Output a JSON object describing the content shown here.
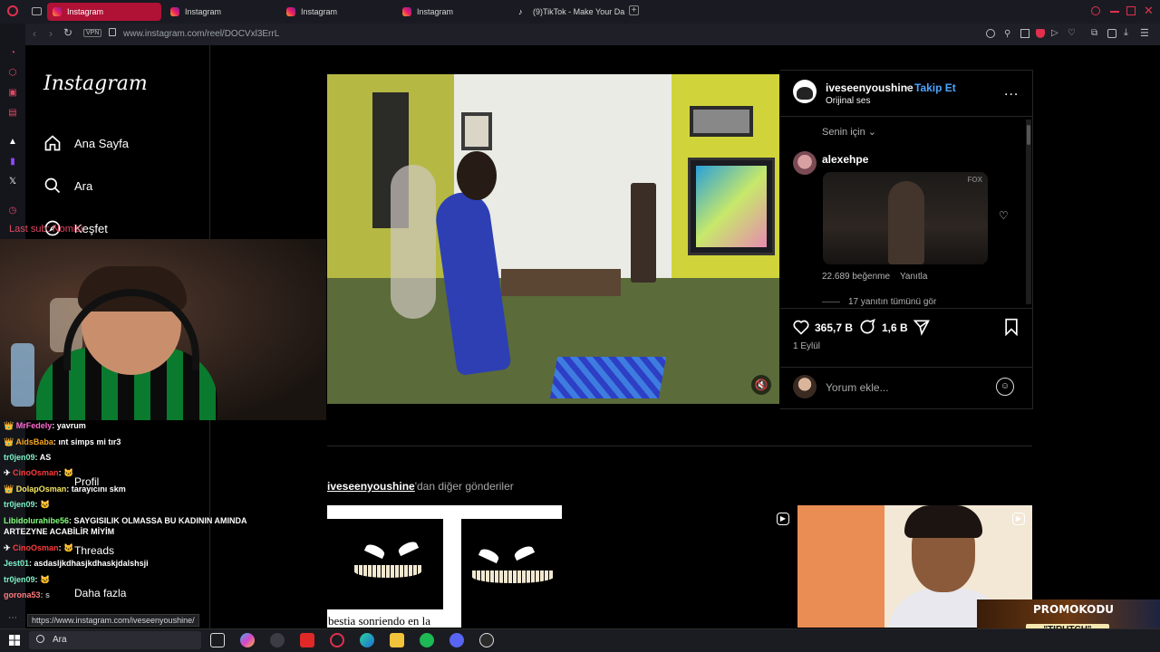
{
  "browser": {
    "tabs": [
      {
        "label": "Instagram",
        "active": true
      },
      {
        "label": "Instagram",
        "active": false
      },
      {
        "label": "Instagram",
        "active": false
      },
      {
        "label": "Instagram",
        "active": false
      },
      {
        "label": "(9)TikTok - Make Your Da",
        "active": false
      }
    ],
    "vpn_label": "VPN",
    "url": "www.instagram.com/reel/DOCVxl3ErrL",
    "status_url": "https://www.instagram.com/iveseenyoushine/"
  },
  "instagram": {
    "logo": "Instagram",
    "nav": [
      {
        "label": "Ana Sayfa",
        "icon": "home-icon"
      },
      {
        "label": "Ara",
        "icon": "search-icon"
      },
      {
        "label": "Keşfet",
        "icon": "compass-icon"
      }
    ],
    "nav_lower": [
      {
        "label": "Profil"
      },
      {
        "label": "Threads"
      },
      {
        "label": "Daha fazla"
      }
    ]
  },
  "overlay": {
    "last_sub": "Last sub: Nomisi"
  },
  "chat": [
    {
      "user": "MrFedely",
      "msg": "yavrum"
    },
    {
      "user": "AidsBaba",
      "msg": "ınt simps mi tır3"
    },
    {
      "user": "tr0jen09",
      "msg": "AS"
    },
    {
      "user": "CinoOsman",
      "msg": "🐱"
    },
    {
      "user": "DolapOsman",
      "msg": "tarayıcını skm"
    },
    {
      "user": "tr0jen09",
      "msg": "🐱"
    },
    {
      "user": "Libidolurahibe56",
      "msg": "SAYGISILIK OLMASSA BU KADININ AMINDA"
    },
    {
      "user": "",
      "msg": "ARTEZYNE ACABİLİR MİYİM"
    },
    {
      "user": "CinoOsman",
      "msg": "🐱"
    },
    {
      "user": "Jest01",
      "msg": "asdasljkdhasjkdhaskjdalshsji"
    },
    {
      "user": "tr0jen09",
      "msg": "🐱"
    },
    {
      "user": "gorona53",
      "msg": "s"
    }
  ],
  "reel": {
    "owner": "iveseenyoushine",
    "follow_label": "Takip Et",
    "audio": "Orijinal ses",
    "more": "...",
    "for_you": "Senin için",
    "comment": {
      "user": "alexehpe",
      "gif_badge": "FOX",
      "likes": "22.689 beğenme",
      "reply": "Yanıtla",
      "view_replies": "17 yanıtın tümünü gör"
    },
    "like_count": "365,7 B",
    "comment_count": "1,6 B",
    "date": "1 Eylül",
    "comment_placeholder": "Yorum ekle..."
  },
  "more_posts": {
    "owner": "iveseenyoushine",
    "suffix": "'dan diğer gönderiler",
    "thumb1_caption": "bestia sonriendo en la"
  },
  "promo": {
    "line1": "PROMOKODU",
    "line2": "\"TIRUTCH\""
  },
  "taskbar": {
    "search_label": "Ara"
  }
}
